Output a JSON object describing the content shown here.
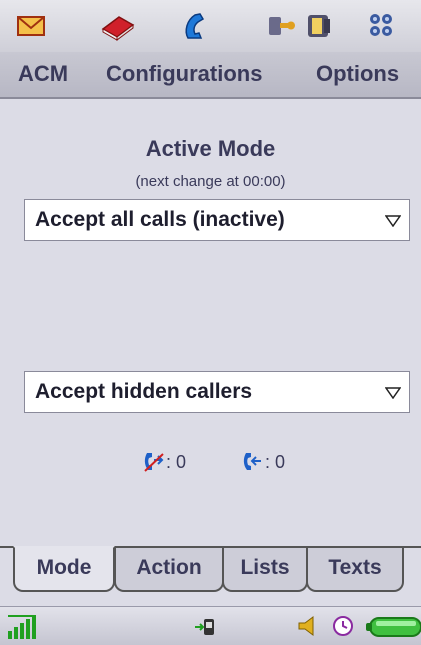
{
  "app_bar": {
    "icons": [
      "mail-icon",
      "book-icon",
      "phone-icon",
      "tools-icon",
      "device-icon",
      "apps-grid-icon"
    ]
  },
  "menu": {
    "items": [
      "ACM",
      "Configurations",
      "Options"
    ]
  },
  "main": {
    "title": "Active Mode",
    "subtitle": "(next change at 00:00)",
    "mode_select": {
      "value": "Accept all calls (inactive)"
    },
    "hidden_callers_select": {
      "value": "Accept hidden callers"
    },
    "counters": {
      "rejected_calls": ": 0",
      "incoming_calls": ": 0"
    }
  },
  "tabs": [
    {
      "label": "Mode",
      "active": true
    },
    {
      "label": "Action",
      "active": false
    },
    {
      "label": "Lists",
      "active": false
    },
    {
      "label": "Texts",
      "active": false
    }
  ],
  "status_bar": {
    "icons": [
      "signal-strength-icon",
      "sim-transfer-icon",
      "volume-icon",
      "alarm-clock-icon",
      "battery-icon"
    ]
  },
  "colors": {
    "menu_text": "#3a3a5a",
    "accent_blue": "#2060c0",
    "signal_green": "#20a020"
  }
}
